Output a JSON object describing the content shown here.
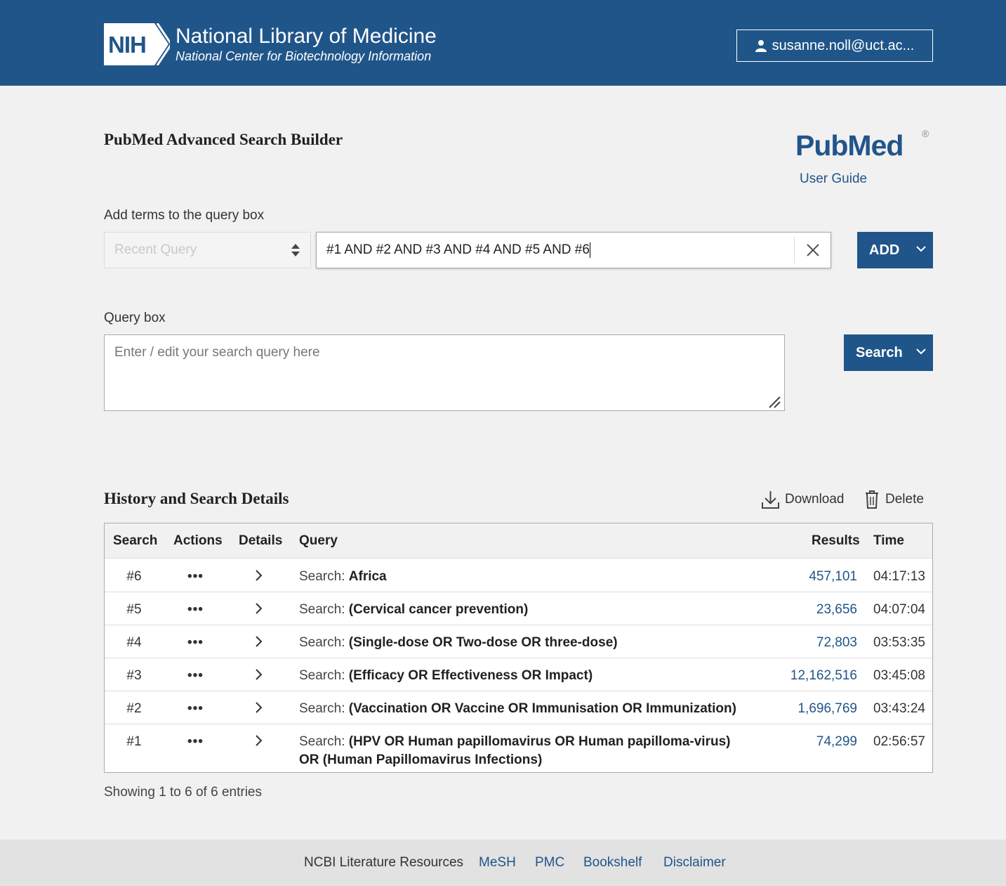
{
  "header": {
    "nih_badge": "NIH",
    "title": "National Library of Medicine",
    "subtitle": "National Center for Biotechnology Information",
    "user": "susanne.noll@uct.ac..."
  },
  "page": {
    "title": "PubMed Advanced Search Builder",
    "logo_text": "PubMed",
    "logo_reg": "®",
    "user_guide": "User Guide"
  },
  "builder": {
    "add_terms_label": "Add terms to the query box",
    "recent_placeholder": "Recent Query",
    "term_value": "#1 AND #2 AND #3 AND #4 AND #5 AND #6",
    "add_label": "ADD",
    "query_box_label": "Query box",
    "query_placeholder": "Enter / edit your search query here",
    "search_label": "Search"
  },
  "history": {
    "title": "History and Search Details",
    "download_label": "Download",
    "delete_label": "Delete",
    "columns": {
      "search": "Search",
      "actions": "Actions",
      "details": "Details",
      "query": "Query",
      "results": "Results",
      "time": "Time"
    },
    "rows": [
      {
        "num": "#6",
        "dots": "•••",
        "prefix": "Search: ",
        "query": "Africa",
        "results": "457,101",
        "time": "04:17:13"
      },
      {
        "num": "#5",
        "dots": "•••",
        "prefix": "Search: ",
        "query": "(Cervical cancer prevention)",
        "results": "23,656",
        "time": "04:07:04"
      },
      {
        "num": "#4",
        "dots": "•••",
        "prefix": "Search: ",
        "query": "(Single-dose OR Two-dose OR three-dose)",
        "results": "72,803",
        "time": "03:53:35"
      },
      {
        "num": "#3",
        "dots": "•••",
        "prefix": "Search: ",
        "query": "(Efficacy OR Effectiveness OR Impact)",
        "results": "12,162,516",
        "time": "03:45:08"
      },
      {
        "num": "#2",
        "dots": "•••",
        "prefix": "Search: ",
        "query": "(Vaccination OR Vaccine OR Immunisation OR Immunization)",
        "results": "1,696,769",
        "time": "03:43:24"
      },
      {
        "num": "#1",
        "dots": "•••",
        "prefix": "Search: ",
        "query": "(HPV OR Human papillomavirus OR Human papilloma-virus) OR (Human Papillomavirus Infections)",
        "results": "74,299",
        "time": "02:56:57"
      }
    ],
    "showing": "Showing 1 to 6 of 6 entries"
  },
  "footer": {
    "label": "NCBI Literature Resources",
    "links": [
      "MeSH",
      "PMC",
      "Bookshelf",
      "Disclaimer"
    ]
  },
  "colors": {
    "brand": "#20558a",
    "page_bg": "#f1f1f1"
  }
}
